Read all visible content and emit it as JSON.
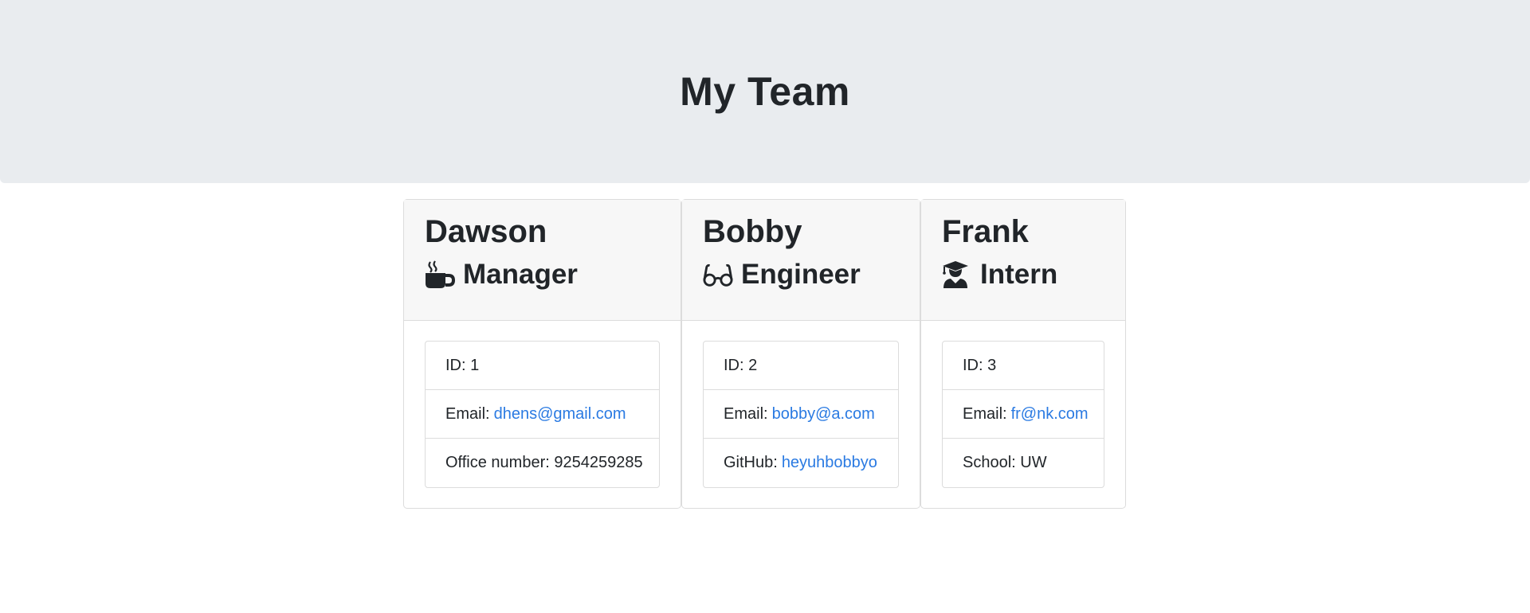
{
  "header": {
    "title": "My Team"
  },
  "employees": [
    {
      "name": "Dawson",
      "role": "Manager",
      "role_icon": "coffee-icon",
      "id_text": "ID: 1",
      "email_label": "Email:",
      "email": "dhens@gmail.com",
      "extra_text": "Office number: 9254259285"
    },
    {
      "name": "Bobby",
      "role": "Engineer",
      "role_icon": "glasses-icon",
      "id_text": "ID: 2",
      "email_label": "Email:",
      "email": "bobby@a.com",
      "extra_label": "GitHub:",
      "extra_link": "heyuhbobbyo"
    },
    {
      "name": "Frank",
      "role": "Intern",
      "role_icon": "graduate-icon",
      "id_text": "ID: 3",
      "email_label": "Email:",
      "email": "fr@nk.com",
      "extra_text": "School: UW"
    }
  ],
  "colors": {
    "header_bg": "#e9ecef",
    "card_header_bg": "#f7f7f7",
    "link": "#2a7ae2",
    "text": "#212529"
  }
}
